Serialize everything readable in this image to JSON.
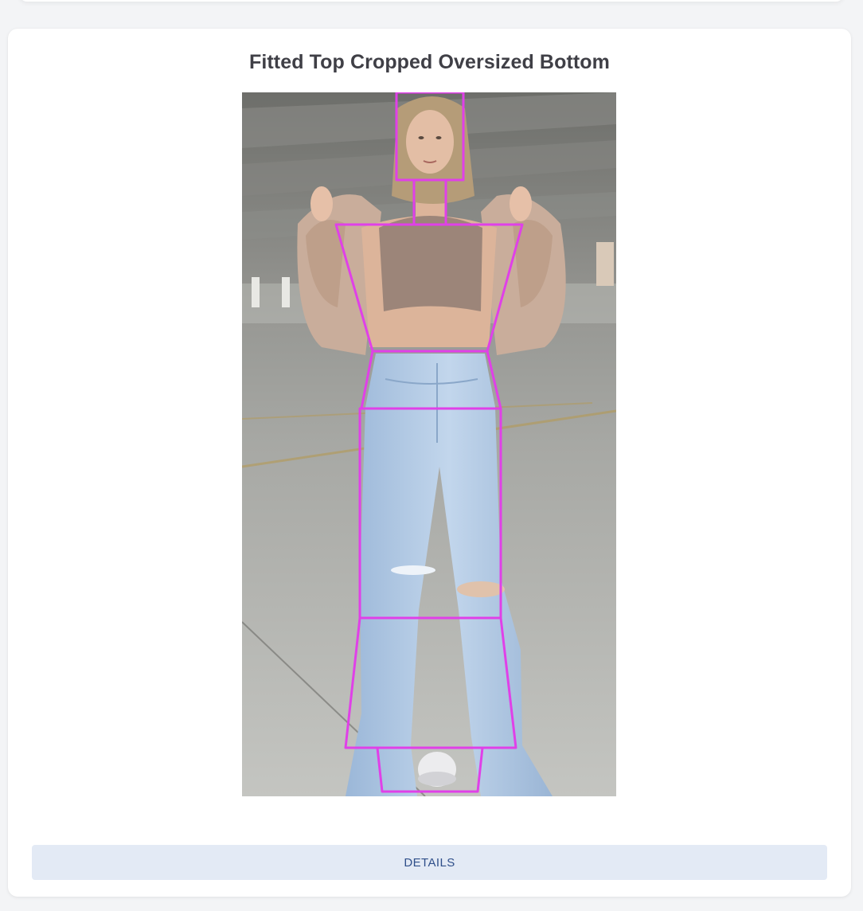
{
  "card": {
    "title": "Fitted Top Cropped Oversized Bottom"
  },
  "photo": {
    "subject": "woman in cropped tank top, knit cardigan and wide-leg light-wash jeans in parking garage",
    "overlay_color": "#e040e8"
  },
  "actions": {
    "details_label": "DETAILS"
  },
  "colors": {
    "button_bg": "#e3eaf5",
    "button_text": "#2f4f8a",
    "title_text": "#3f3f46",
    "overlay": "#e040e8"
  }
}
